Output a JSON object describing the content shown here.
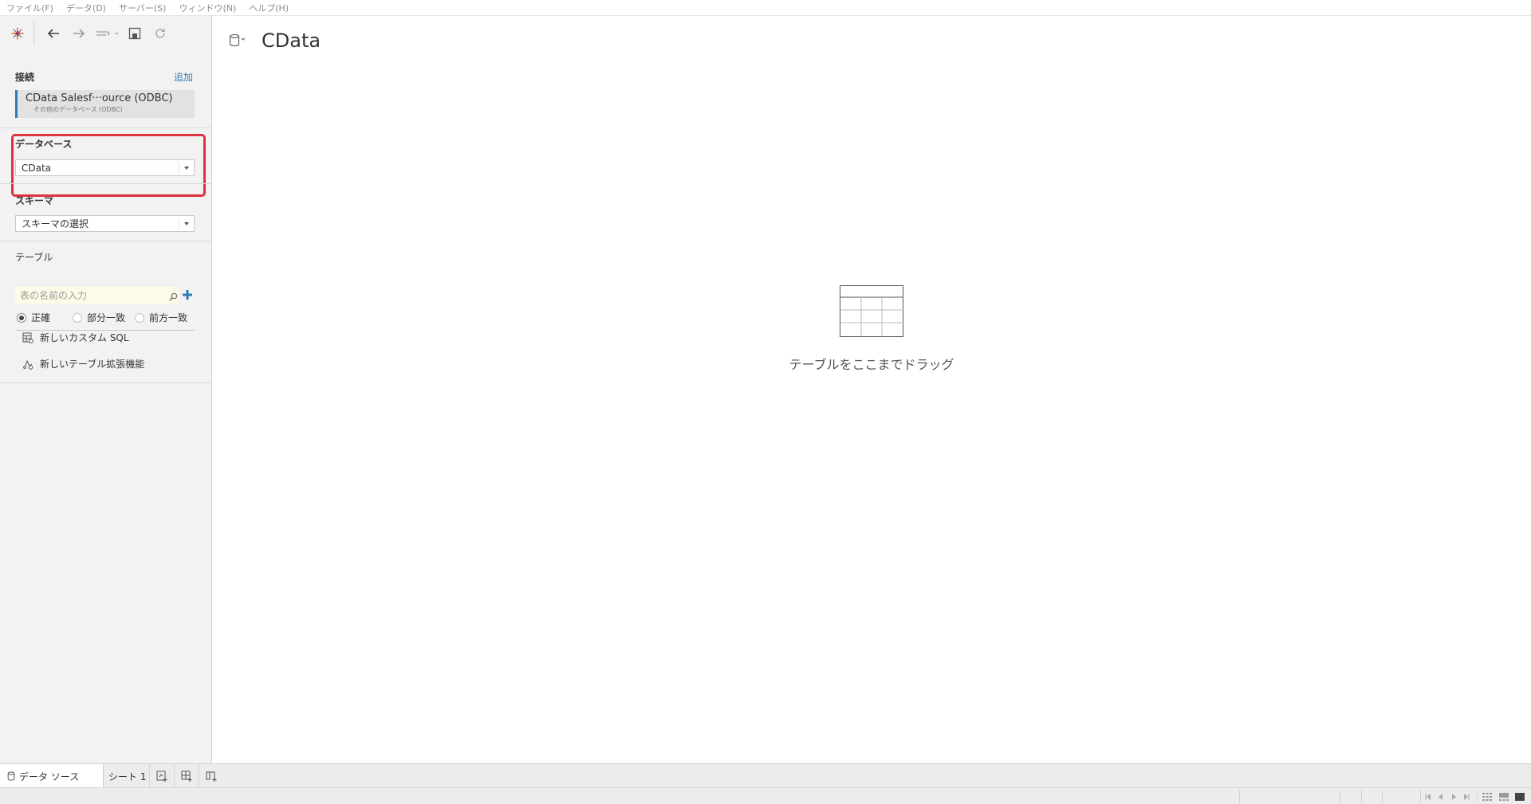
{
  "menu": [
    "ファイル(F)",
    "データ(D)",
    "サーバー(S)",
    "ウィンドウ(N)",
    "ヘルプ(H)"
  ],
  "sidebar": {
    "connections_label": "接続",
    "add_label": "追加",
    "connection": {
      "name": "CData Salesf···ource (ODBC)",
      "type": "その他のデータベース (ODBC)"
    },
    "database_label": "データベース",
    "database_value": "CData",
    "schema_label": "スキーマ",
    "schema_value": "スキーマの選択",
    "table_label": "テーブル",
    "table_search_placeholder": "表の名前の入力",
    "match_options": [
      "正確",
      "部分一致",
      "前方一致"
    ],
    "match_selected": "正確",
    "custom_sql_label": "新しいカスタム SQL",
    "table_extension_label": "新しいテーブル拡張機能"
  },
  "main": {
    "datasource_title": "CData",
    "drop_hint": "テーブルをここまでドラッグ"
  },
  "tabs": {
    "datasource_tab": "データ ソース",
    "sheet_tab": "シート 1"
  },
  "colors": {
    "accent": "#2f7ab9",
    "highlight": "#e0303c",
    "sidebar_bg": "#f2f2f2"
  }
}
